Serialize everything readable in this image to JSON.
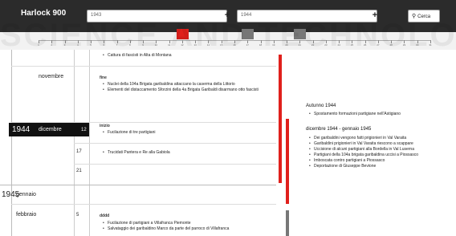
{
  "header": {
    "app_name": "Harlock 900",
    "start_year": "1943",
    "end_year": "1944",
    "add_label": "+",
    "search_label": "Cerca"
  },
  "timeline": {
    "ticks": [
      "1",
      "2",
      "3",
      "4",
      "5",
      "6",
      "7",
      "8",
      "9",
      "10",
      "11",
      "12",
      "13",
      "14",
      "15",
      "16",
      "17",
      "18",
      "19",
      "20",
      "21",
      "22",
      "23",
      "24",
      "25",
      "26",
      "27",
      "28",
      "29",
      "30",
      "31"
    ],
    "markers": [
      {
        "color": "#e0201c",
        "position": 12
      },
      {
        "color": "#777777",
        "position": 17
      },
      {
        "color": "#777777",
        "position": 21
      }
    ]
  },
  "watermark": "SCIENCE AND TECHNOLOGY",
  "left": {
    "rows": [
      {
        "month": "",
        "day": "",
        "note": "",
        "events": [
          "Cattura di fascisti in Alta di Montana"
        ]
      },
      {
        "month": "novembre",
        "day": "",
        "note": "fine",
        "events": [
          "Nuclei della 104a Brigata garibaldina attaccano la caserma della Littorio",
          "Elementi del distaccamento Sforzini della 4a Brigata Garibaldi disarmano otto fascisti"
        ]
      },
      {
        "year": "1944",
        "month": "dicembre",
        "day": "12",
        "note": "inizio",
        "events": [
          "Fucilazione di tre partigiani"
        ]
      },
      {
        "month": "",
        "day": "17",
        "note": "",
        "events": [
          "Trucidati Pantera e Re alla Gabiola"
        ]
      },
      {
        "month": "",
        "day": "21",
        "note": "",
        "events": []
      },
      {
        "year": "1945",
        "month": "gennaio",
        "day": "",
        "note": "",
        "events": []
      },
      {
        "month": "febbraio",
        "day": "5",
        "note": "dddd",
        "events": [
          "Fucilazione di partigiani a Villafranca Piemonte",
          "Salvataggio dei garibaldino Marco da parte del parroco di Villafranca"
        ]
      }
    ]
  },
  "right": {
    "blocks": [
      {
        "title": "Autunno 1944",
        "events": [
          "Spostamento formazioni partigiane nell'Astigiano"
        ]
      },
      {
        "title": "dicembre 1944 - gennaio 1945",
        "events": [
          "Dei garibaldini vengono fatti prigionieri in Val Varaita",
          "Garibaldini prigionieri in Val Varaita riescono a scappare",
          "Uccisione di alcuni partigiani alla Bordella in Val Luserna",
          "Partigiani della 104a brigata garibaldina uccisi a Piossasco",
          "Imboscata contro partigiani a Piossasco",
          "Deportazione di Giuseppe Bevione"
        ]
      }
    ]
  },
  "colors": {
    "accent": "#e0201c",
    "header": "#2b2b2b",
    "grey": "#777777"
  }
}
